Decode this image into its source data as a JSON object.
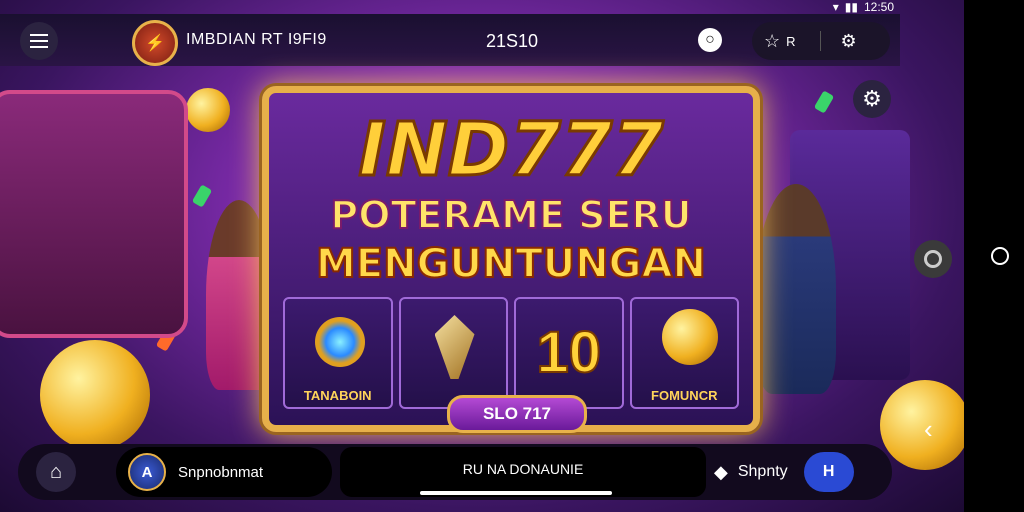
{
  "status": {
    "time": "12:50"
  },
  "header": {
    "app_title": "IMBDIAN RT I9FI9",
    "balance": "21S10"
  },
  "banner": {
    "headline": "IND777",
    "subline1": "POTERAME SERU",
    "subline2": "MENGUNTUNGAN",
    "slot_left_label": "TANABOIN",
    "slot_number": "10",
    "slot_right_label": "FOMUNCR",
    "cta_label": "SLO 717"
  },
  "bottom": {
    "profile_label": "Snpnobnmat",
    "center_label": "RU NA DONAUNIE",
    "right_label": "Shpnty"
  },
  "colors": {
    "accent_gold": "#e7b04a",
    "purple": "#7a2aa8"
  }
}
